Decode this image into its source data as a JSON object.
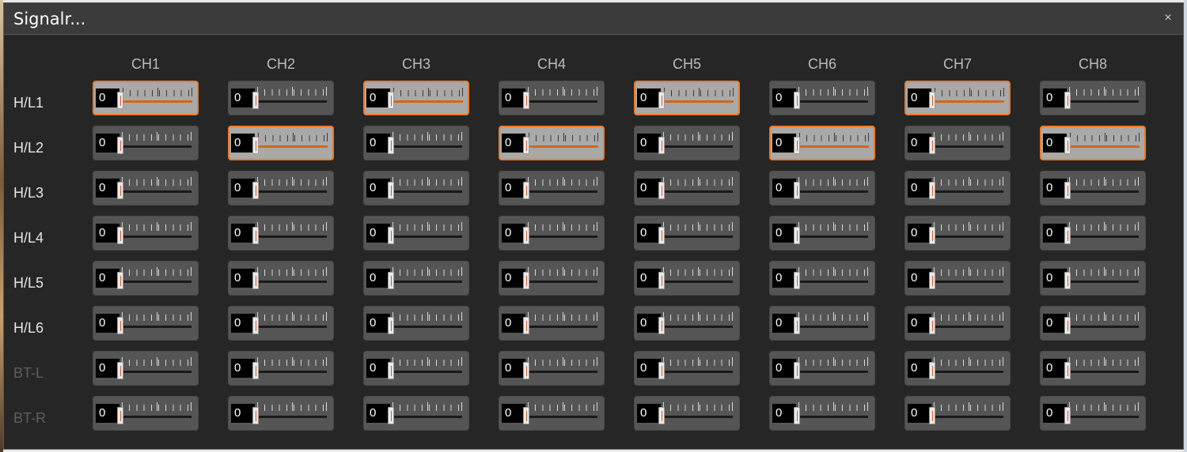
{
  "window": {
    "title": "Signalr...",
    "close_label": "×"
  },
  "channels": [
    "CH1",
    "CH2",
    "CH3",
    "CH4",
    "CH5",
    "CH6",
    "CH7",
    "CH8"
  ],
  "rows": [
    {
      "label": "H/L1",
      "enabled": true,
      "values": [
        "0",
        "0",
        "0",
        "0",
        "0",
        "0",
        "0",
        "0"
      ],
      "active": [
        true,
        false,
        true,
        false,
        true,
        false,
        true,
        false
      ]
    },
    {
      "label": "H/L2",
      "enabled": true,
      "values": [
        "0",
        "0",
        "0",
        "0",
        "0",
        "0",
        "0",
        "0"
      ],
      "active": [
        false,
        true,
        false,
        true,
        false,
        true,
        false,
        true
      ]
    },
    {
      "label": "H/L3",
      "enabled": true,
      "values": [
        "0",
        "0",
        "0",
        "0",
        "0",
        "0",
        "0",
        "0"
      ],
      "active": [
        false,
        false,
        false,
        false,
        false,
        false,
        false,
        false
      ]
    },
    {
      "label": "H/L4",
      "enabled": true,
      "values": [
        "0",
        "0",
        "0",
        "0",
        "0",
        "0",
        "0",
        "0"
      ],
      "active": [
        false,
        false,
        false,
        false,
        false,
        false,
        false,
        false
      ]
    },
    {
      "label": "H/L5",
      "enabled": true,
      "values": [
        "0",
        "0",
        "0",
        "0",
        "0",
        "0",
        "0",
        "0"
      ],
      "active": [
        false,
        false,
        false,
        false,
        false,
        false,
        false,
        false
      ]
    },
    {
      "label": "H/L6",
      "enabled": true,
      "values": [
        "0",
        "0",
        "0",
        "0",
        "0",
        "0",
        "0",
        "0"
      ],
      "active": [
        false,
        false,
        false,
        false,
        false,
        false,
        false,
        false
      ]
    },
    {
      "label": "BT-L",
      "enabled": false,
      "values": [
        "0",
        "0",
        "0",
        "0",
        "0",
        "0",
        "0",
        "0"
      ],
      "active": [
        false,
        false,
        false,
        false,
        false,
        false,
        false,
        false
      ]
    },
    {
      "label": "BT-R",
      "enabled": false,
      "values": [
        "0",
        "0",
        "0",
        "0",
        "0",
        "0",
        "0",
        "0"
      ],
      "active": [
        false,
        false,
        false,
        false,
        false,
        false,
        false,
        false
      ]
    }
  ],
  "colors": {
    "accent": "#f07a28",
    "active_fill": "#a9a9a9",
    "slider_fill": "#555555",
    "background": "#262626"
  },
  "icons": {
    "close": "close-icon"
  }
}
